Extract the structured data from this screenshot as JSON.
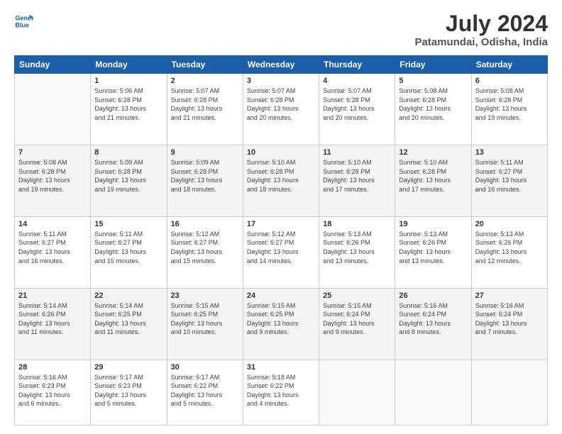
{
  "header": {
    "logo_line1": "General",
    "logo_line2": "Blue",
    "month_year": "July 2024",
    "location": "Patamundai, Odisha, India"
  },
  "days_of_week": [
    "Sunday",
    "Monday",
    "Tuesday",
    "Wednesday",
    "Thursday",
    "Friday",
    "Saturday"
  ],
  "weeks": [
    [
      {
        "num": "",
        "info": ""
      },
      {
        "num": "1",
        "info": "Sunrise: 5:06 AM\nSunset: 6:28 PM\nDaylight: 13 hours\nand 21 minutes."
      },
      {
        "num": "2",
        "info": "Sunrise: 5:07 AM\nSunset: 6:28 PM\nDaylight: 13 hours\nand 21 minutes."
      },
      {
        "num": "3",
        "info": "Sunrise: 5:07 AM\nSunset: 6:28 PM\nDaylight: 13 hours\nand 20 minutes."
      },
      {
        "num": "4",
        "info": "Sunrise: 5:07 AM\nSunset: 6:28 PM\nDaylight: 13 hours\nand 20 minutes."
      },
      {
        "num": "5",
        "info": "Sunrise: 5:08 AM\nSunset: 6:28 PM\nDaylight: 13 hours\nand 20 minutes."
      },
      {
        "num": "6",
        "info": "Sunrise: 5:08 AM\nSunset: 6:28 PM\nDaylight: 13 hours\nand 19 minutes."
      }
    ],
    [
      {
        "num": "7",
        "info": "Sunrise: 5:08 AM\nSunset: 6:28 PM\nDaylight: 13 hours\nand 19 minutes."
      },
      {
        "num": "8",
        "info": "Sunrise: 5:09 AM\nSunset: 6:28 PM\nDaylight: 13 hours\nand 19 minutes."
      },
      {
        "num": "9",
        "info": "Sunrise: 5:09 AM\nSunset: 6:28 PM\nDaylight: 13 hours\nand 18 minutes."
      },
      {
        "num": "10",
        "info": "Sunrise: 5:10 AM\nSunset: 6:28 PM\nDaylight: 13 hours\nand 18 minutes."
      },
      {
        "num": "11",
        "info": "Sunrise: 5:10 AM\nSunset: 6:28 PM\nDaylight: 13 hours\nand 17 minutes."
      },
      {
        "num": "12",
        "info": "Sunrise: 5:10 AM\nSunset: 6:28 PM\nDaylight: 13 hours\nand 17 minutes."
      },
      {
        "num": "13",
        "info": "Sunrise: 5:11 AM\nSunset: 6:27 PM\nDaylight: 13 hours\nand 16 minutes."
      }
    ],
    [
      {
        "num": "14",
        "info": "Sunrise: 5:11 AM\nSunset: 6:27 PM\nDaylight: 13 hours\nand 16 minutes."
      },
      {
        "num": "15",
        "info": "Sunrise: 5:11 AM\nSunset: 6:27 PM\nDaylight: 13 hours\nand 15 minutes."
      },
      {
        "num": "16",
        "info": "Sunrise: 5:12 AM\nSunset: 6:27 PM\nDaylight: 13 hours\nand 15 minutes."
      },
      {
        "num": "17",
        "info": "Sunrise: 5:12 AM\nSunset: 6:27 PM\nDaylight: 13 hours\nand 14 minutes."
      },
      {
        "num": "18",
        "info": "Sunrise: 5:13 AM\nSunset: 6:26 PM\nDaylight: 13 hours\nand 13 minutes."
      },
      {
        "num": "19",
        "info": "Sunrise: 5:13 AM\nSunset: 6:26 PM\nDaylight: 13 hours\nand 13 minutes."
      },
      {
        "num": "20",
        "info": "Sunrise: 5:13 AM\nSunset: 6:26 PM\nDaylight: 13 hours\nand 12 minutes."
      }
    ],
    [
      {
        "num": "21",
        "info": "Sunrise: 5:14 AM\nSunset: 6:26 PM\nDaylight: 13 hours\nand 11 minutes."
      },
      {
        "num": "22",
        "info": "Sunrise: 5:14 AM\nSunset: 6:25 PM\nDaylight: 13 hours\nand 11 minutes."
      },
      {
        "num": "23",
        "info": "Sunrise: 5:15 AM\nSunset: 6:25 PM\nDaylight: 13 hours\nand 10 minutes."
      },
      {
        "num": "24",
        "info": "Sunrise: 5:15 AM\nSunset: 6:25 PM\nDaylight: 13 hours\nand 9 minutes."
      },
      {
        "num": "25",
        "info": "Sunrise: 5:15 AM\nSunset: 6:24 PM\nDaylight: 13 hours\nand 9 minutes."
      },
      {
        "num": "26",
        "info": "Sunrise: 5:16 AM\nSunset: 6:24 PM\nDaylight: 13 hours\nand 8 minutes."
      },
      {
        "num": "27",
        "info": "Sunrise: 5:16 AM\nSunset: 6:24 PM\nDaylight: 13 hours\nand 7 minutes."
      }
    ],
    [
      {
        "num": "28",
        "info": "Sunrise: 5:16 AM\nSunset: 6:23 PM\nDaylight: 13 hours\nand 6 minutes."
      },
      {
        "num": "29",
        "info": "Sunrise: 5:17 AM\nSunset: 6:23 PM\nDaylight: 13 hours\nand 5 minutes."
      },
      {
        "num": "30",
        "info": "Sunrise: 5:17 AM\nSunset: 6:22 PM\nDaylight: 13 hours\nand 5 minutes."
      },
      {
        "num": "31",
        "info": "Sunrise: 5:18 AM\nSunset: 6:22 PM\nDaylight: 13 hours\nand 4 minutes."
      },
      {
        "num": "",
        "info": ""
      },
      {
        "num": "",
        "info": ""
      },
      {
        "num": "",
        "info": ""
      }
    ]
  ]
}
